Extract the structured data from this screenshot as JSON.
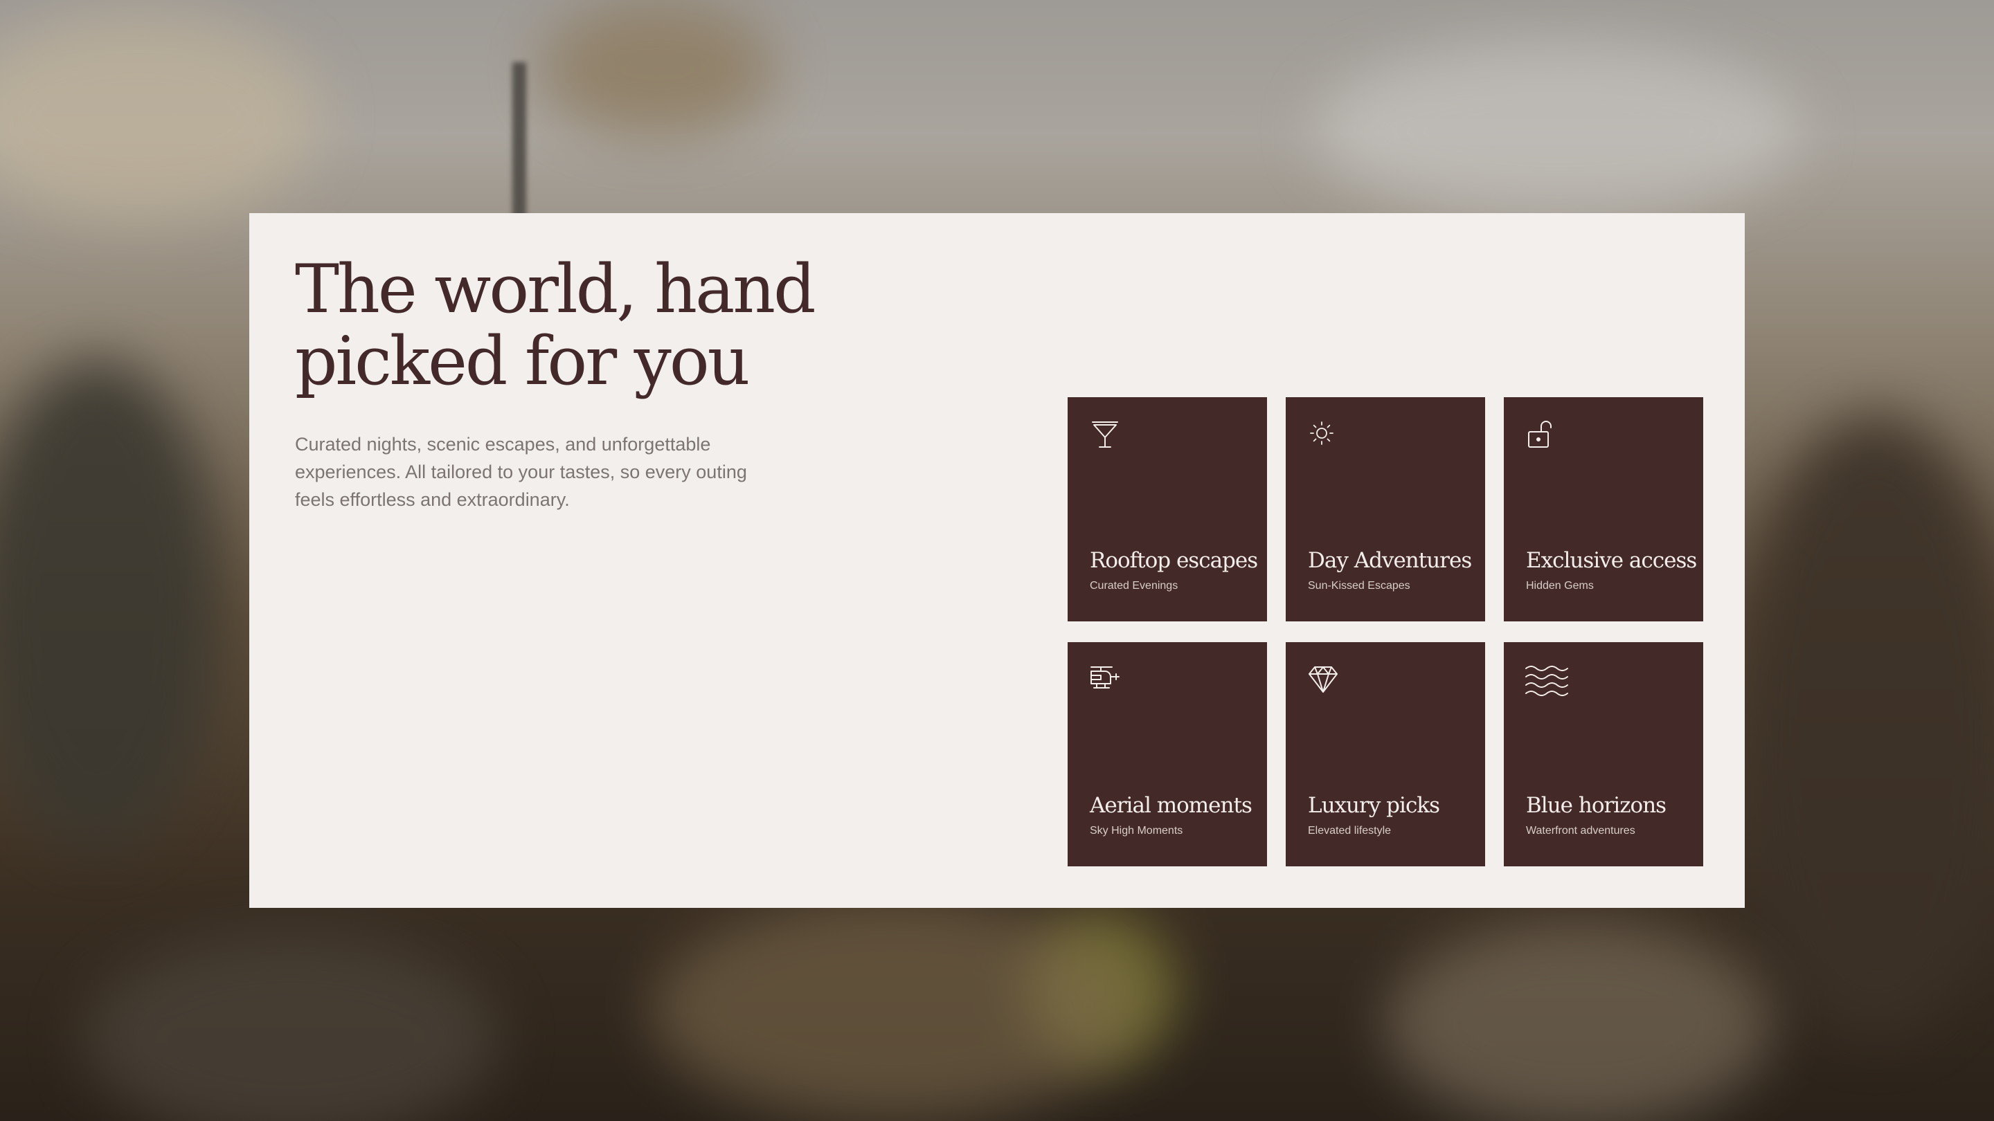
{
  "hero": {
    "headline": "The world, hand picked for you",
    "lede": "Curated nights, scenic escapes, and unforgettable experiences. All tailored to your tastes, so every outing feels effortless and extraordinary."
  },
  "colors": {
    "tile_background": "#432927",
    "panel_background": "#f2efed",
    "headline_text": "#44292a",
    "body_text": "#7c7472"
  },
  "tiles": [
    {
      "icon": "cocktail-glass-icon",
      "title": "Rooftop escapes",
      "subtitle": "Curated Evenings"
    },
    {
      "icon": "sun-icon",
      "title": "Day Adventures",
      "subtitle": "Sun-Kissed Escapes"
    },
    {
      "icon": "unlocked-padlock-icon",
      "title": "Exclusive access",
      "subtitle": "Hidden Gems"
    },
    {
      "icon": "helicopter-icon",
      "title": "Aerial moments",
      "subtitle": "Sky High Moments"
    },
    {
      "icon": "diamond-icon",
      "title": "Luxury picks",
      "subtitle": "Elevated lifestyle"
    },
    {
      "icon": "waves-icon",
      "title": "Blue horizons",
      "subtitle": "Waterfront adventures"
    }
  ]
}
